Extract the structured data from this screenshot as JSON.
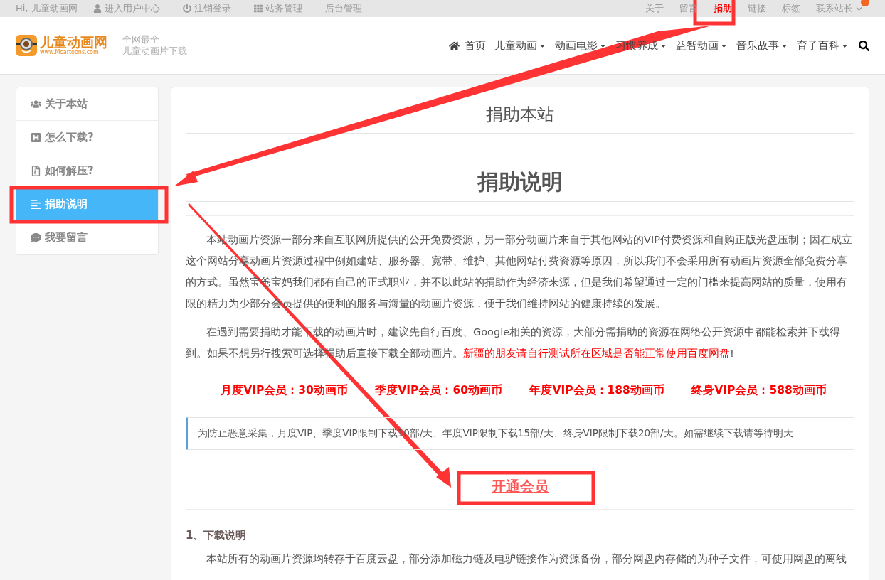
{
  "top_bar": {
    "greeting": "Hi, 儿童动画网",
    "left_links": [
      {
        "kind": "user",
        "label": "进入用户中心"
      },
      {
        "kind": "power",
        "label": "注销登录"
      },
      {
        "kind": "grid",
        "label": "站务管理"
      },
      {
        "kind": "plain",
        "label": "后台管理"
      }
    ],
    "right_links": [
      {
        "label": "关于",
        "selected": false,
        "dropdown": false,
        "alert": false
      },
      {
        "label": "留言",
        "selected": false,
        "dropdown": false,
        "alert": false
      },
      {
        "label": "捐助",
        "selected": true,
        "dropdown": false,
        "alert": false
      },
      {
        "label": "链接",
        "selected": false,
        "dropdown": false,
        "alert": false
      },
      {
        "label": "标签",
        "selected": false,
        "dropdown": false,
        "alert": false
      },
      {
        "label": "联系站长",
        "selected": false,
        "dropdown": true,
        "alert": true
      }
    ]
  },
  "header": {
    "logo_text": "儿童动画网",
    "logo_url": "www.Mcartoons.com",
    "tagline": [
      "全网最全",
      "儿童动画片下载"
    ],
    "nav": [
      {
        "label": "首页",
        "kind": "home"
      },
      {
        "label": "儿童动画",
        "kind": "dropdown"
      },
      {
        "label": "动画电影",
        "kind": "dropdown"
      },
      {
        "label": "习惯养成",
        "kind": "dropdown"
      },
      {
        "label": "益智动画",
        "kind": "dropdown"
      },
      {
        "label": "音乐故事",
        "kind": "dropdown"
      },
      {
        "label": "育子百科",
        "kind": "dropdown"
      }
    ]
  },
  "sidebar": {
    "items": [
      {
        "label": "关于本站",
        "kind": "users",
        "selected": false
      },
      {
        "label": "怎么下载?",
        "kind": "h-square",
        "selected": false
      },
      {
        "label": "如何解压?",
        "kind": "archive",
        "selected": false
      },
      {
        "label": "捐助说明",
        "kind": "lines",
        "selected": true
      },
      {
        "label": "我要留言",
        "kind": "comment",
        "selected": false
      }
    ]
  },
  "article": {
    "page_title": "捐助本站",
    "heading": "捐助说明",
    "paragraphs": [
      [
        {
          "kind": "normal",
          "text": "本站动画片资源一部分来自互联网所提供的公开免费资源，另一部分动画片来自于其他网站的VIP付费资源和自购正版光盘压制；因在成立这个网站分享动画片资源过程中例如建站、服务器、宽带、维护、其他网站付费资源等原因，所以我们不会采用所有动画片资源全部免费分享的方式。虽然宝爸宝妈我们都有自己的正式职业，并不以此站的捐助作为经济来源，但是我们希望通过一定的门槛来提高网站的质量，使用有限的精力为少部分会员提供的便利的服务与海量的动画片资源，便于我们维持网站的健康持续的发展。"
        }
      ],
      [
        {
          "kind": "normal",
          "text": "在遇到需要捐助才能下载的动画片时，建议先自行百度、Google相关的资源，大部分需捐助的资源在网络公开资源中都能检索并下载得到。如果不想另行搜索可选择捐助后直接下载全部动画片。"
        },
        {
          "kind": "warning",
          "text": "新疆的朋友请自行测试所在区域是否能正常使用百度网盘"
        },
        {
          "kind": "normal",
          "text": "!"
        }
      ]
    ],
    "prices": [
      "月度VIP会员：30动画币",
      "季度VIP会员：60动画币",
      "年度VIP会员：188动画币",
      "终身VIP会员：588动画币"
    ],
    "notice": "为防止恶意采集，月度VIP、季度VIP限制下载10部/天、年度VIP限制下载15部/天、终身VIP限制下载20部/天。如需继续下载请等待明天",
    "cta": "开通会员",
    "section_heading": "1、下载说明",
    "section_text": "本站所有的动画片资源均转存于百度云盘，部分添加磁力链及电驴链接作为资源备份，部分网盘内存储的为种子文件，可使用网盘的离线"
  }
}
